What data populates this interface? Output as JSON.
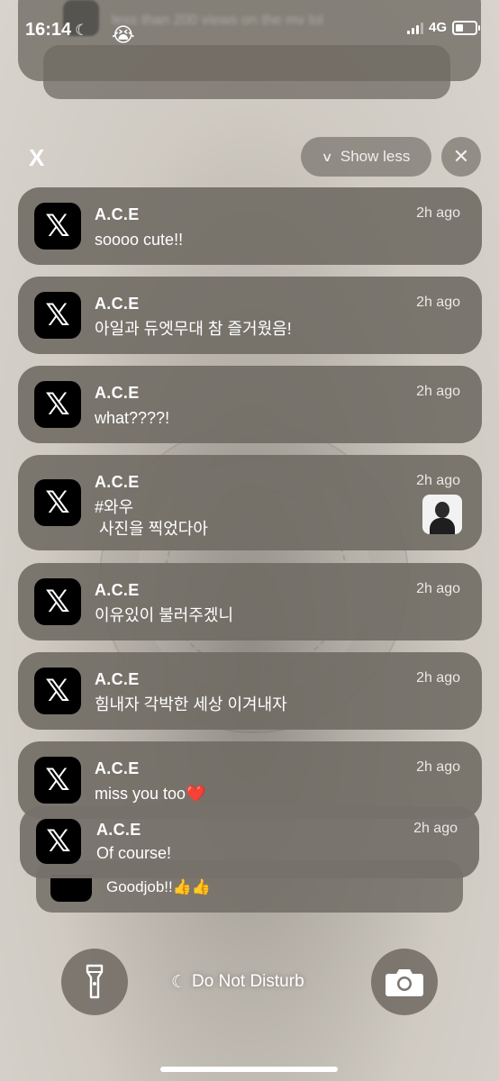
{
  "status_bar": {
    "time": "16:14",
    "network": "4G"
  },
  "previous_stack": {
    "blurred_text": "less than 200 views on the mv lol",
    "emoji": "😭"
  },
  "group": {
    "title": "X",
    "show_less_label": "Show less",
    "close_symbol": "✕"
  },
  "notifications": [
    {
      "app_glyph": "𝕏",
      "sender": "A.C.E",
      "time": "2h ago",
      "message": "soooo cute!!"
    },
    {
      "app_glyph": "𝕏",
      "sender": "A.C.E",
      "time": "2h ago",
      "message": "아일과 듀엣무대 참 즐거웠음!"
    },
    {
      "app_glyph": "𝕏",
      "sender": "A.C.E",
      "time": "2h ago",
      "message": "what????!"
    },
    {
      "app_glyph": "𝕏",
      "sender": "A.C.E",
      "time": "2h ago",
      "message": "#와우\n 사진을 찍었다아"
    },
    {
      "app_glyph": "𝕏",
      "sender": "A.C.E",
      "time": "2h ago",
      "message": "이유있이 불러주겠니"
    },
    {
      "app_glyph": "𝕏",
      "sender": "A.C.E",
      "time": "2h ago",
      "message": "힘내자 각박한 세상 이겨내자"
    },
    {
      "app_glyph": "𝕏",
      "sender": "A.C.E",
      "time": "2h ago",
      "message": "miss you too❤️"
    },
    {
      "app_glyph": "𝕏",
      "sender": "A.C.E",
      "time": "2h ago",
      "message": "Of course!"
    }
  ],
  "stacked_under": {
    "message": "Goodjob!!👍👍"
  },
  "bottom": {
    "focus_label": "Do Not Disturb",
    "flashlight_icon": "flashlight-icon",
    "camera_icon": "camera-icon"
  },
  "colors": {
    "card": "#706b64",
    "wallpaper": "#d8d4cd",
    "heart": "#e0202b"
  }
}
